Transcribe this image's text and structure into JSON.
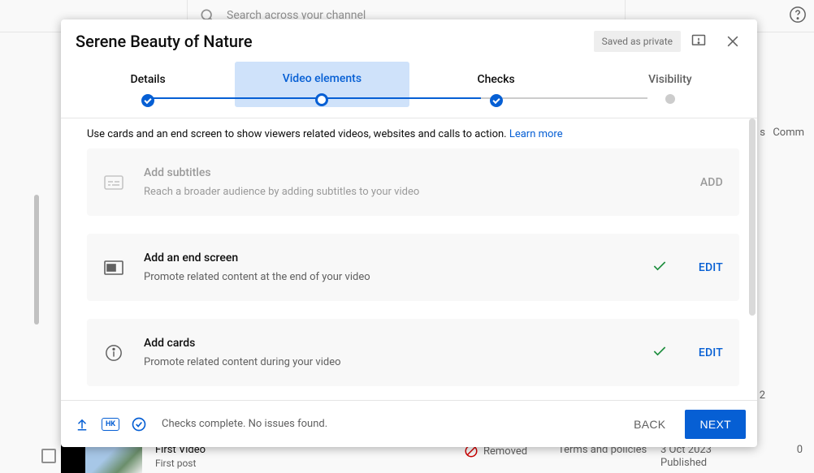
{
  "background": {
    "search_placeholder": "Search across your channel",
    "row_title": "First Video",
    "row_subtitle": "First post",
    "row_status": "Removed",
    "col_terms": "Terms and policies",
    "col_date": "3 Oct 2023",
    "col_published": "Published",
    "col_zero": "0",
    "col_two": "2",
    "header_comments": "Comm",
    "header_s": "s"
  },
  "modal": {
    "title": "Serene Beauty of Nature",
    "saved_badge": "Saved as private",
    "steps": [
      {
        "label": "Details"
      },
      {
        "label": "Video elements"
      },
      {
        "label": "Checks"
      },
      {
        "label": "Visibility"
      }
    ],
    "intro_text": "Use cards and an end screen to show viewers related videos, websites and calls to action. ",
    "learn_more": "Learn more",
    "cards": [
      {
        "title": "Add subtitles",
        "desc": "Reach a broader audience by adding subtitles to your video",
        "action": "ADD"
      },
      {
        "title": "Add an end screen",
        "desc": "Promote related content at the end of your video",
        "action": "EDIT"
      },
      {
        "title": "Add cards",
        "desc": "Promote related content during your video",
        "action": "EDIT"
      }
    ],
    "footer": {
      "hd_label": "HK",
      "status": "Checks complete. No issues found.",
      "back": "BACK",
      "next": "NEXT"
    }
  }
}
